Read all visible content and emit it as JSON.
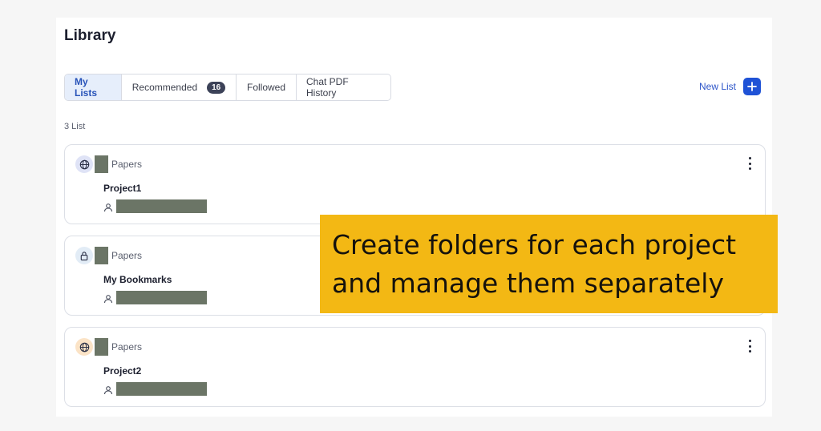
{
  "header": {
    "title": "Library"
  },
  "tabs": [
    {
      "label": "My Lists",
      "active": true
    },
    {
      "label": "Recommended",
      "badge": "16"
    },
    {
      "label": "Followed"
    },
    {
      "label": "Chat PDF History"
    }
  ],
  "new_list": {
    "label": "New List",
    "icon": "plus-icon"
  },
  "list_count": "3 List",
  "lists": [
    {
      "name": "Project1",
      "papers_label": "Papers",
      "visibility_icon": "globe-icon",
      "icon_bg": "#dfe3f6"
    },
    {
      "name": "My Bookmarks",
      "papers_label": "Papers",
      "visibility_icon": "lock-icon",
      "icon_bg": "#e2ecf6"
    },
    {
      "name": "Project2",
      "papers_label": "Papers",
      "visibility_icon": "globe-icon",
      "icon_bg": "#fbe3c6"
    }
  ],
  "callout": {
    "line1": "Create folders for each project",
    "line2": "and manage them separately"
  },
  "colors": {
    "accent": "#1f52d6",
    "callout_bg": "#f3b814",
    "redaction": "#6b7566"
  }
}
